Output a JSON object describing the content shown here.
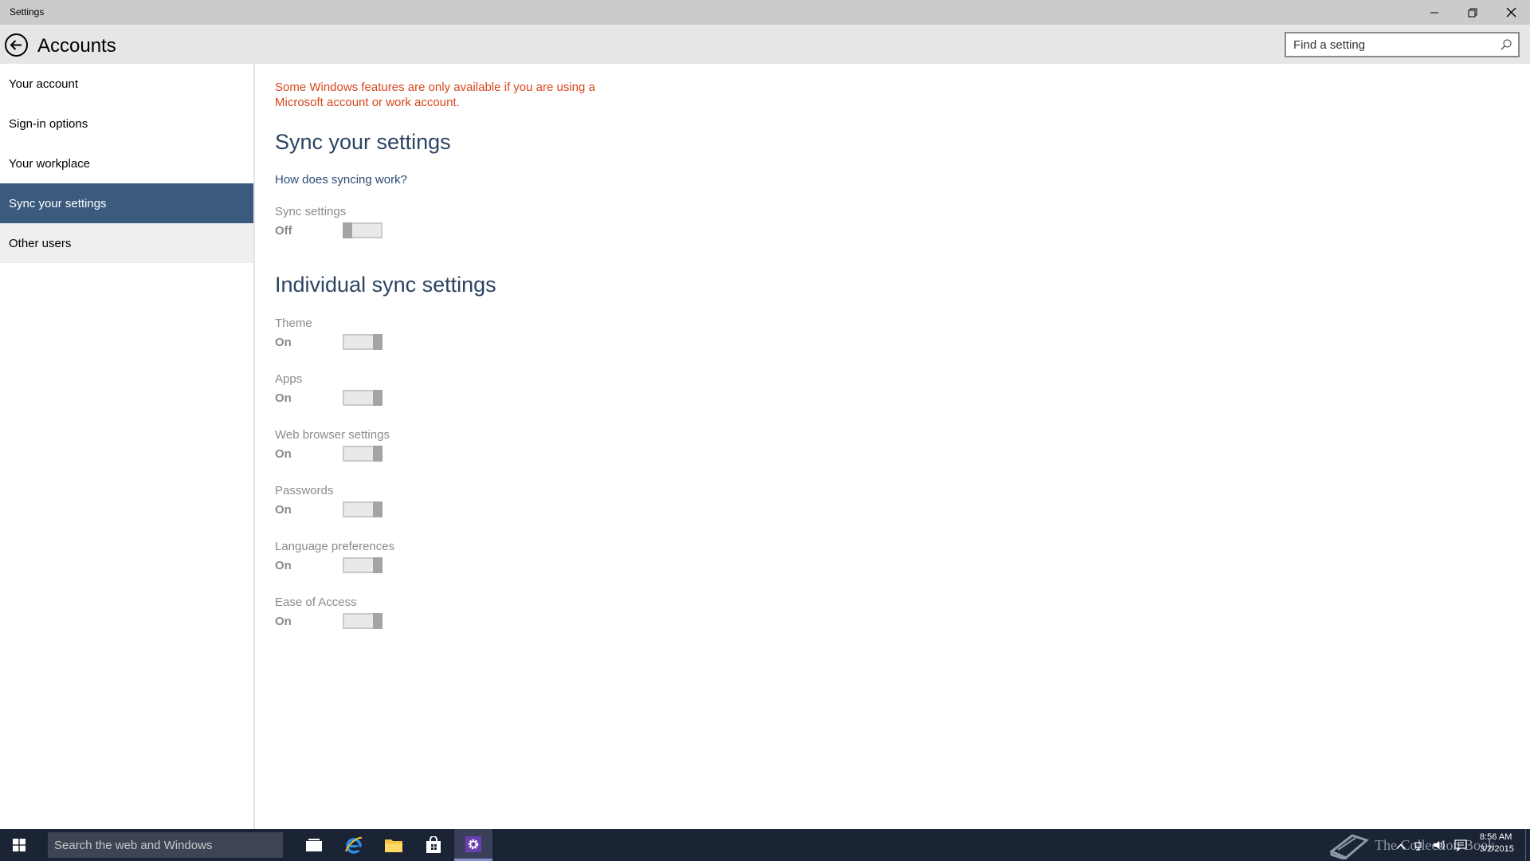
{
  "window": {
    "title": "Settings"
  },
  "header": {
    "title": "Accounts",
    "search_placeholder": "Find a setting"
  },
  "sidebar": {
    "items": [
      {
        "label": "Your account"
      },
      {
        "label": "Sign-in options"
      },
      {
        "label": "Your workplace"
      },
      {
        "label": "Sync your settings",
        "selected": true
      },
      {
        "label": "Other users"
      }
    ]
  },
  "content": {
    "warning": "Some Windows features are only available if you are using a Microsoft account or work account.",
    "sync_title": "Sync your settings",
    "how_link": "How does syncing work?",
    "sync_settings": {
      "label": "Sync settings",
      "state": "Off"
    },
    "individual_title": "Individual sync settings",
    "individual": [
      {
        "label": "Theme",
        "state": "On"
      },
      {
        "label": "Apps",
        "state": "On"
      },
      {
        "label": "Web browser settings",
        "state": "On"
      },
      {
        "label": "Passwords",
        "state": "On"
      },
      {
        "label": "Language preferences",
        "state": "On"
      },
      {
        "label": "Ease of Access",
        "state": "On"
      }
    ]
  },
  "taskbar": {
    "search_placeholder": "Search the web and Windows",
    "watermark": "The Collection Book",
    "time": "8:56 AM",
    "date": "3/2/2015",
    "accent_color": "#3a5a7e"
  }
}
